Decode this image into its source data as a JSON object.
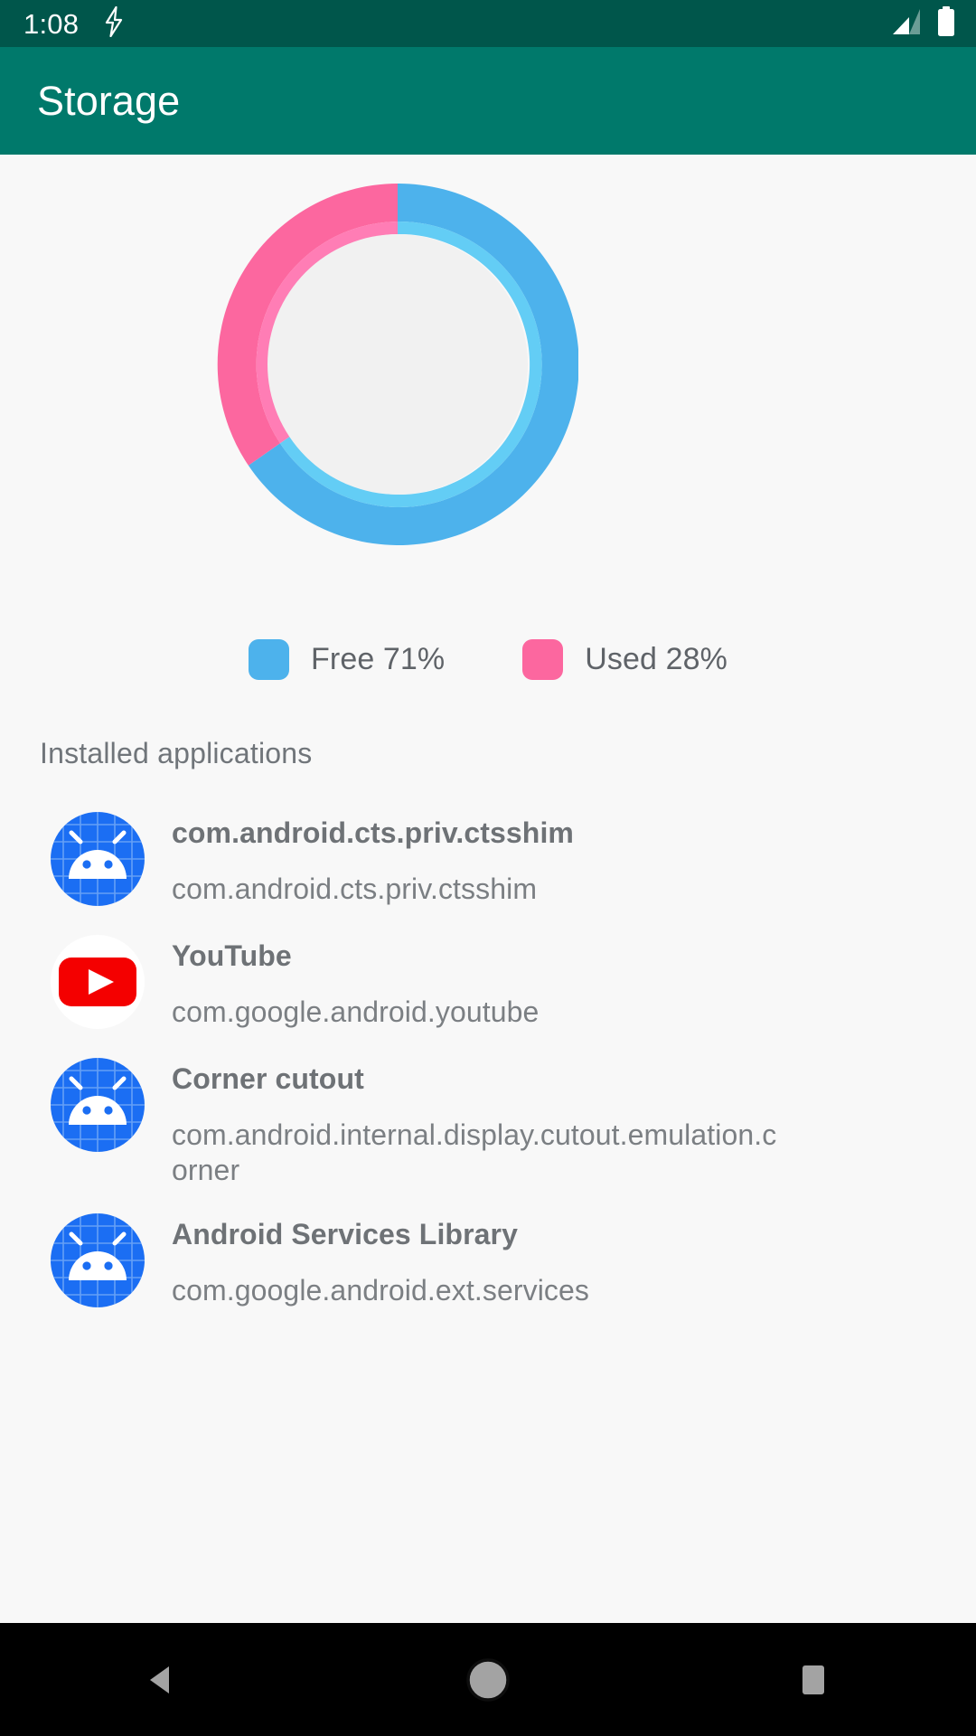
{
  "status_bar": {
    "clock": "1:08",
    "icons": [
      "bolt-icon",
      "signal-icon",
      "battery-icon"
    ],
    "background": "#00564b"
  },
  "app_bar": {
    "title": "Storage",
    "background": "#00796b",
    "title_color": "#ffffff"
  },
  "chart_data": {
    "type": "pie",
    "variant": "donut",
    "title": "",
    "categories": [
      "Free",
      "Used"
    ],
    "values": [
      71,
      28
    ],
    "labels": [
      "Free 71%",
      "Used 28%"
    ],
    "colors": [
      "#4db2ec",
      "#fc679f"
    ],
    "inner_ring_colors": [
      "#63cdf5",
      "#ff7db5"
    ],
    "center_color": "#f1f1f1",
    "unit": "%",
    "legend_position": "bottom",
    "start_angle": 0,
    "direction": "free-clockwise-used-counterclockwise"
  },
  "legend": {
    "items": [
      {
        "label": "Free 71%",
        "color": "#4db2ec",
        "name": "free"
      },
      {
        "label": "Used 28%",
        "color": "#fc679f",
        "name": "used"
      }
    ]
  },
  "section": {
    "header": "Installed applications"
  },
  "apps": [
    {
      "name": "com.android.cts.priv.ctsshim",
      "package": "com.android.cts.priv.ctsshim",
      "icon": "android-default-icon"
    },
    {
      "name": "YouTube",
      "package": "com.google.android.youtube",
      "icon": "youtube-icon"
    },
    {
      "name": "Corner cutout",
      "package": "com.android.internal.display.cutout.emulation.corner",
      "icon": "android-default-icon"
    },
    {
      "name": "Android Services Library",
      "package": "com.google.android.ext.services",
      "icon": "android-default-icon"
    }
  ],
  "nav_bar": {
    "back_label": "Back",
    "home_label": "Home",
    "recents_label": "Recents",
    "background": "#000000",
    "icon_color": "#a3a3a3"
  }
}
